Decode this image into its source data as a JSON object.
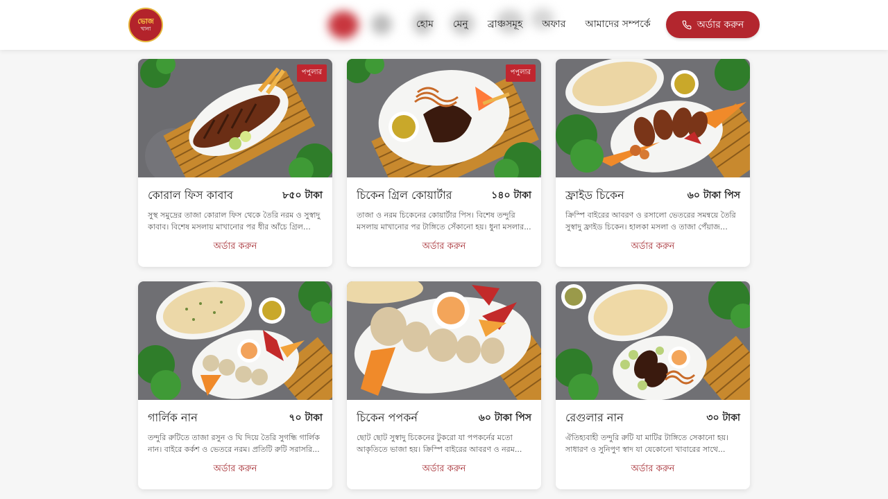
{
  "header": {
    "logo_line1": "ভোজ",
    "logo_line2": "খানা",
    "nav": [
      {
        "label": "হোম"
      },
      {
        "label": "মেনু"
      },
      {
        "label": "ব্রাঞ্চসমূহ"
      },
      {
        "label": "অফার"
      },
      {
        "label": "আমাদের সম্পর্কে"
      }
    ],
    "order_button": "অর্ডার করুন",
    "phone_icon": "phone-icon"
  },
  "menu": {
    "items": [
      {
        "name": "কোরাল ফিস কাবাব",
        "price": "৮৫০ টাকা",
        "desc": "সুস্থ সমুদ্রের তাজা কোরাল ফিস থেকে তৈরি নরম ও সুস্বাদু কাবাব। বিশেষ মসলায় মাখানোর পর ধীর আঁচে গ্রিল করা...",
        "badge": "পপুলার",
        "link": "অর্ডার করুন"
      },
      {
        "name": "চিকেন গ্রিল কোয়ার্টার",
        "price": "১৪০ টাকা",
        "desc": "তাজা ও নরম চিকেনের কোয়ার্টার পিস। বিশেষ তন্দুরি মসলায় মাখানোর পর টাঙ্গিতে সেঁকানো হয়। ধুনা মসলার...",
        "badge": "পপুলার",
        "link": "অর্ডার করুন"
      },
      {
        "name": "ফ্রাইড চিকেন",
        "price": "৬০ টাকা পিস",
        "desc": "ক্রিস্পি বাইরের আবরণ ও রসালো ভেতরের সমন্বয়ে তৈরি সুস্বাদু ফ্রাইড চিকেন। হালকা মসলা ও তাজা পেঁয়াজ দিয়ে...",
        "badge": "",
        "link": "অর্ডার করুন"
      },
      {
        "name": "গার্লিক নান",
        "price": "৭০ টাকা",
        "desc": "তন্দুরি রুটিতে তাজা রসুন ও ঘি দিয়ে তৈরি সুগন্ধি গার্লিক নান। বাইরে কর্কশ ও ভেতরে নরম। প্রতিটি রুটি সরাসরি...",
        "badge": "",
        "link": "অর্ডার করুন"
      },
      {
        "name": "চিকেন পপকর্ন",
        "price": "৬০ টাকা পিস",
        "desc": "ছোট ছোট সুস্বাদু চিকেনের টুকরো যা পপকর্নের মতো আকৃতিতে ভাজা হয়। ক্রিস্পি বাইরের আবরণ ও নরম...",
        "badge": "",
        "link": "অর্ডার করুন"
      },
      {
        "name": "রেগুলার নান",
        "price": "৩০ টাকা",
        "desc": "ঐতিহ্যবাহী তন্দুরি রুটি যা মাটির টাঙ্গিতে সেকানো হয়। সাধারণ ও সুনিপুণ স্বাদ যা যেকোনো খাবারের সাথে...",
        "badge": "",
        "link": "অর্ডার করুন"
      }
    ]
  },
  "colors": {
    "brand": "#b3262e",
    "table_stone": "#6e6e70",
    "plate": "#f4f4f4",
    "greens": "#2f7d2a",
    "bamboo": "#c8892e"
  }
}
